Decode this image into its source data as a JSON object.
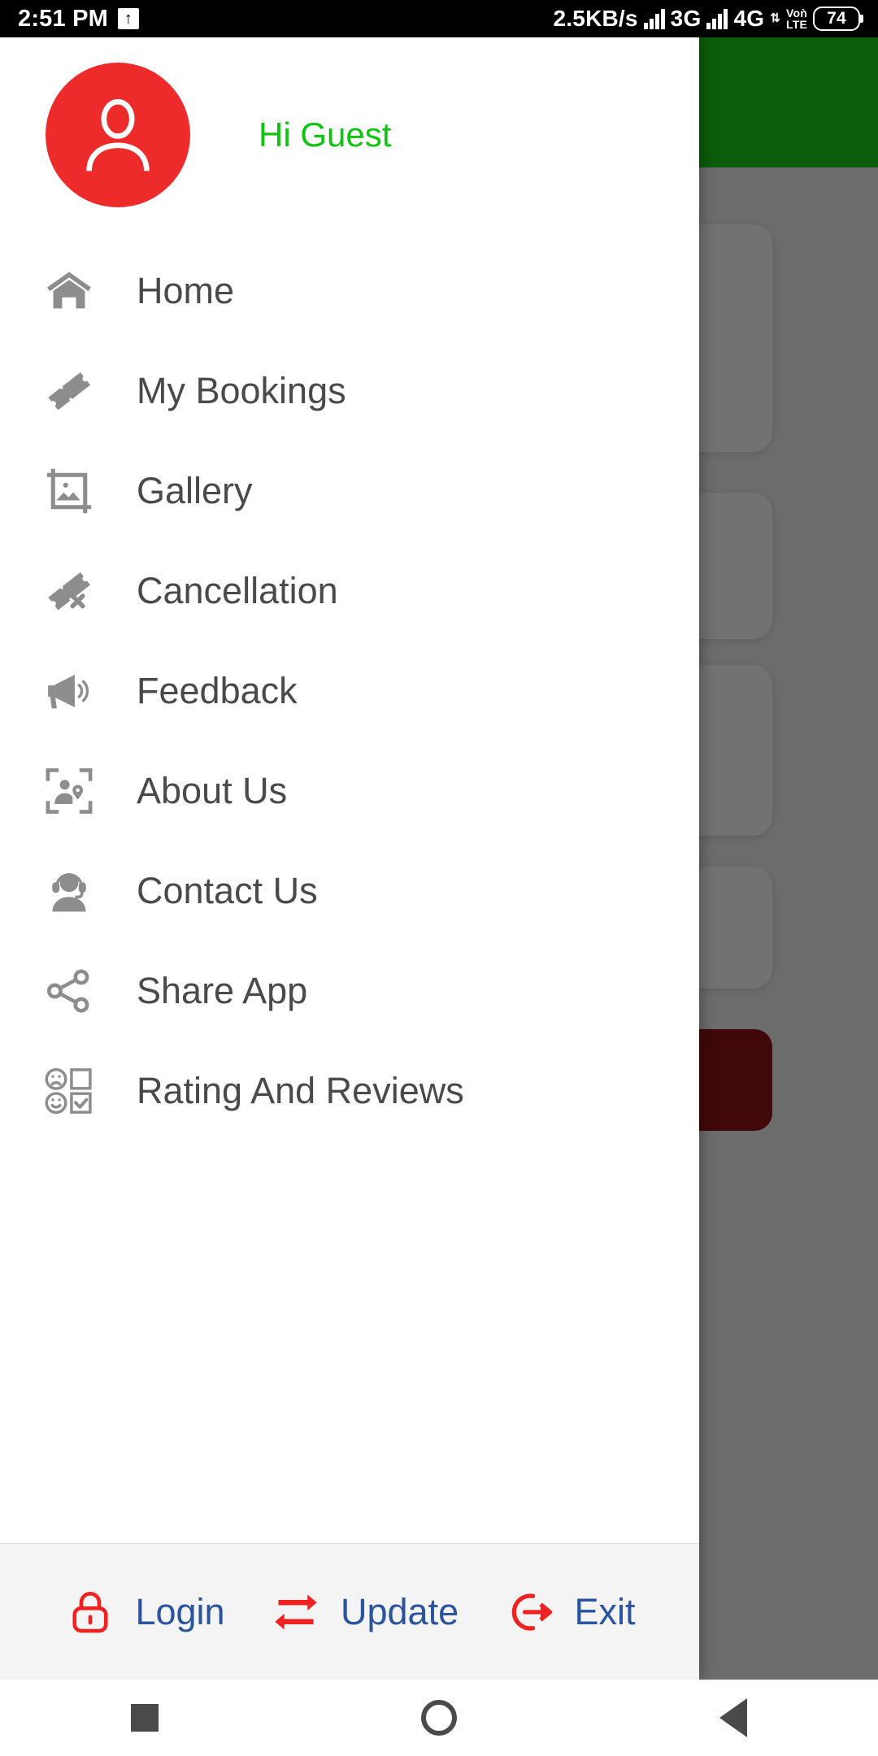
{
  "statusbar": {
    "time": "2:51 PM",
    "upload_badge": "↑",
    "data_rate": "2.5KB/s",
    "network_3g": "3G",
    "network_4g": "4G",
    "volte_top": "Voǹ",
    "volte_bottom": "LTE",
    "battery": "74"
  },
  "drawer": {
    "greeting": "Hi Guest",
    "avatar_icon": "person-avatar-icon",
    "items": [
      {
        "label": "Home",
        "icon": "home-icon"
      },
      {
        "label": "My Bookings",
        "icon": "ticket-icon"
      },
      {
        "label": "Gallery",
        "icon": "image-crop-icon"
      },
      {
        "label": "Cancellation",
        "icon": "ticket-cancel-icon"
      },
      {
        "label": "Feedback",
        "icon": "megaphone-icon"
      },
      {
        "label": "About Us",
        "icon": "person-location-frame-icon"
      },
      {
        "label": "Contact Us",
        "icon": "headset-support-icon"
      },
      {
        "label": "Share App",
        "icon": "share-nodes-icon"
      },
      {
        "label": "Rating And Reviews",
        "icon": "rating-faces-checkbox-icon"
      }
    ]
  },
  "actionbar": {
    "actions": [
      {
        "label": "Login",
        "icon": "lock-icon"
      },
      {
        "label": "Update",
        "icon": "swap-arrows-icon"
      },
      {
        "label": "Exit",
        "icon": "exit-arrow-icon"
      }
    ]
  },
  "navbar": {
    "recents": "square-recents-icon",
    "home": "circle-home-icon",
    "back": "triangle-back-icon"
  },
  "colors": {
    "avatar_red": "#ee2b2b",
    "greeting_green": "#0ec40e",
    "action_icon_red": "#ef2222",
    "action_label_blue": "#2a54a0",
    "menu_text": "#4a4a4a",
    "menu_icon": "#8d8d8d",
    "app_header_green": "#0b5c0b",
    "bg_button_red": "#8e1313"
  }
}
